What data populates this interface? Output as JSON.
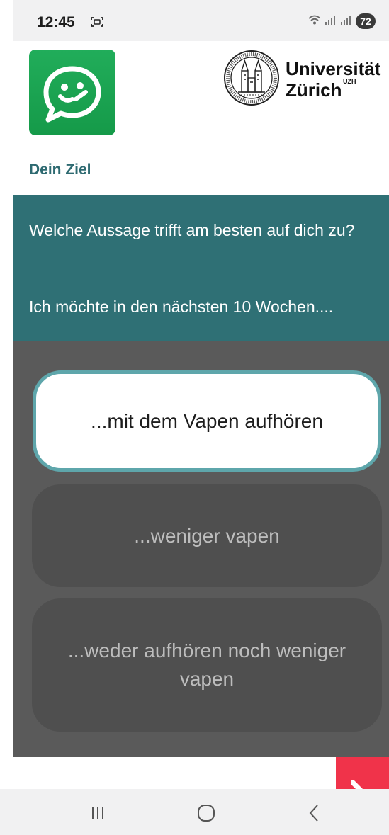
{
  "status_bar": {
    "time": "12:45",
    "battery_level": "72",
    "icons": [
      "screenshot-icon",
      "wifi-icon",
      "signal-icon",
      "signal-icon",
      "battery-icon"
    ]
  },
  "header": {
    "app_logo_icon": "smiling-chat-bubble-icon",
    "university": {
      "name": "Universität",
      "city": "Zürich",
      "abbreviation": "UZH"
    }
  },
  "section_title": "Dein Ziel",
  "question": {
    "text": "Welche Aussage trifft am besten auf dich zu?",
    "lead": "Ich möchte in den nächsten 10 Wochen...."
  },
  "options": [
    {
      "label": "...mit dem Vapen aufhören",
      "selected": true
    },
    {
      "label": "...weniger vapen",
      "selected": false
    },
    {
      "label": "...weder aufhören noch weniger vapen",
      "selected": false
    }
  ],
  "colors": {
    "header_teal": "#2f7075",
    "title_teal": "#2e6a71",
    "app_green": "#1aa352",
    "selected_border": "#5ea6ab",
    "overlay_gray": "#5a5a5a",
    "fab_red": "#f0334a"
  },
  "nav_bar": {
    "icons": [
      "recents-icon",
      "home-icon",
      "back-icon"
    ]
  }
}
